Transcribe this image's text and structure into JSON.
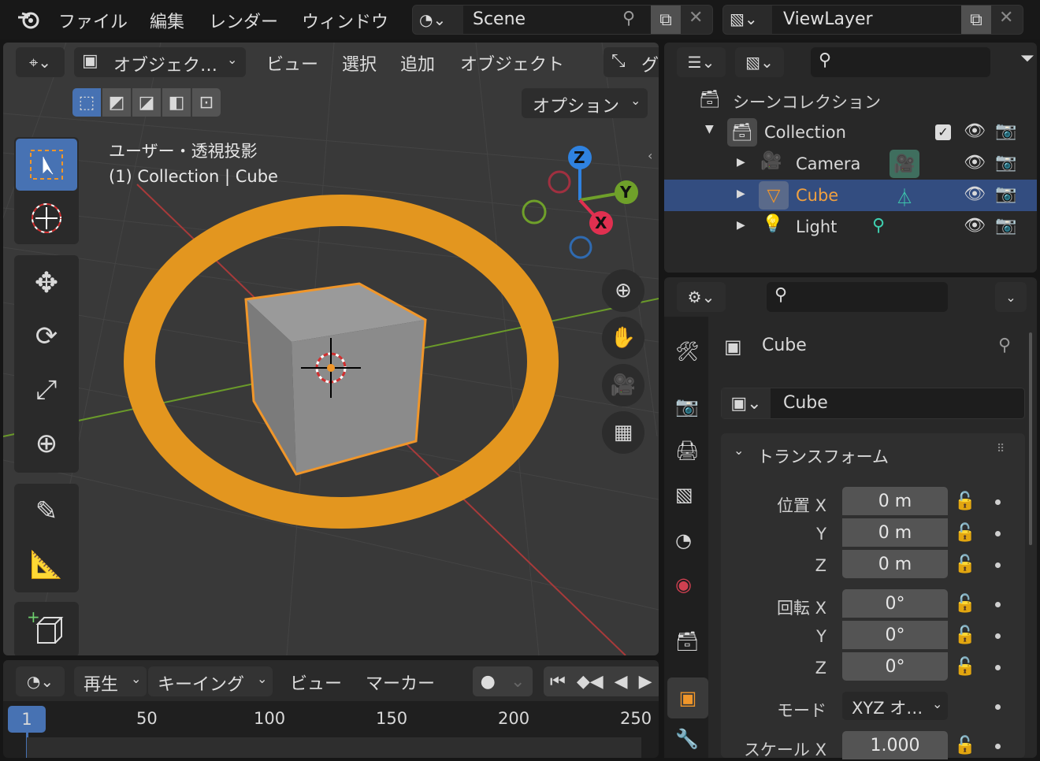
{
  "topbar": {
    "menus": [
      "ファイル",
      "編集",
      "レンダー",
      "ウィンドウ"
    ],
    "scene": "Scene",
    "viewlayer": "ViewLayer"
  },
  "viewport": {
    "mode": "オブジェク…",
    "menus": [
      "ビュー",
      "選択",
      "追加",
      "オブジェクト",
      "グ"
    ],
    "options": "オプション",
    "view_name": "ユーザー・透視投影",
    "context": "(1) Collection | Cube",
    "gizmo": {
      "x": "X",
      "y": "Y",
      "z": "Z"
    }
  },
  "outliner": {
    "root": "シーンコレクション",
    "collection": "Collection",
    "items": [
      "Camera",
      "Cube",
      "Light"
    ]
  },
  "properties": {
    "object_name": "Cube",
    "datablock": "Cube",
    "panel": "トランスフォーム",
    "location_label": "位置 X",
    "rotation_label": "回転 X",
    "mode_label": "モード",
    "scale_label": "スケール X",
    "y": "Y",
    "z": "Z",
    "loc": [
      "0 m",
      "0 m",
      "0 m"
    ],
    "rot": [
      "0°",
      "0°",
      "0°"
    ],
    "mode": "XYZ オ…",
    "scale_x": "1.000"
  },
  "timeline": {
    "menus": [
      "再生",
      "キーイング",
      "ビュー",
      "マーカー"
    ],
    "current_frame": "1",
    "ticks": [
      "50",
      "100",
      "150",
      "200",
      "250"
    ]
  },
  "colors": {
    "accent": "#f0962a",
    "selected_row": "#334d80",
    "active_tab": "#4772b3"
  }
}
